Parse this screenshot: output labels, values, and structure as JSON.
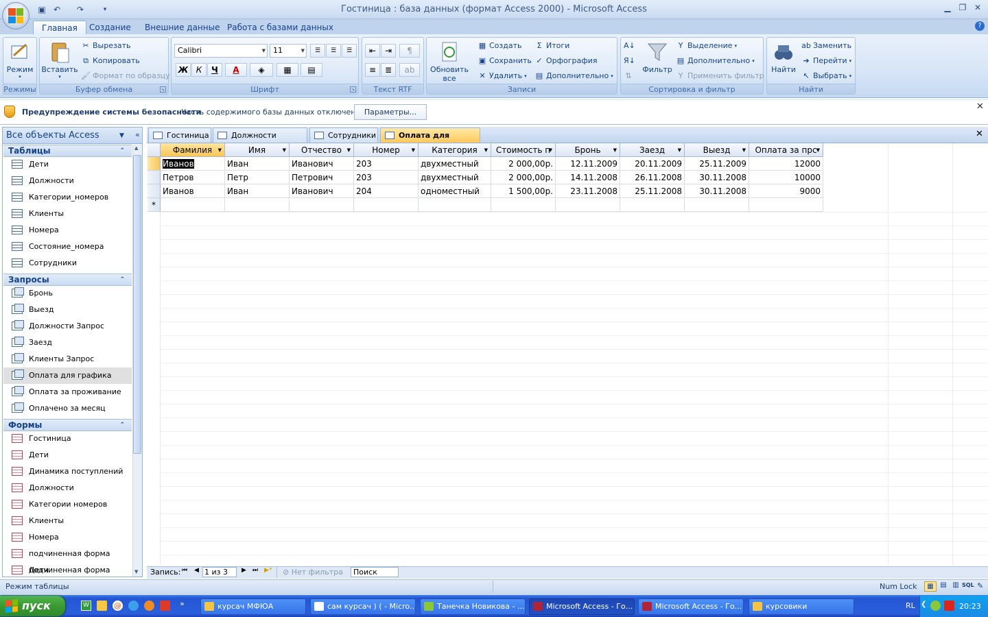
{
  "window": {
    "title": "Гостиница : база данных (формат Access 2000)  -  Microsoft Access",
    "minimize": "▁",
    "restore": "❐",
    "close": "✕"
  },
  "ribbon_tabs": [
    "Главная",
    "Создание",
    "Внешние данные",
    "Работа с базами данных"
  ],
  "ribbon": {
    "modes": {
      "label": "Режимы",
      "view": "Режим"
    },
    "clipboard": {
      "label": "Буфер обмена",
      "paste": "Вставить",
      "cut": "Вырезать",
      "copy": "Копировать",
      "format_painter": "Формат по образцу"
    },
    "font": {
      "label": "Шрифт",
      "font_name": "Calibri",
      "font_size": "11",
      "bold": "Ж",
      "italic": "К",
      "underline": "Ч",
      "font_color": "A"
    },
    "rtf": {
      "label": "Текст RTF"
    },
    "records": {
      "label": "Записи",
      "refresh": "Обновить все",
      "new": "Создать",
      "save": "Сохранить",
      "delete": "Удалить",
      "totals": "Итоги",
      "spelling": "Орфография",
      "more": "Дополнительно"
    },
    "sort_filter": {
      "label": "Сортировка и фильтр",
      "filter": "Фильтр",
      "selection": "Выделение",
      "advanced": "Дополнительно",
      "toggle_filter": "Применить фильтр"
    },
    "find": {
      "label": "Найти",
      "find": "Найти",
      "replace": "Заменить",
      "goto": "Перейти",
      "select": "Выбрать"
    }
  },
  "security_bar": {
    "title": "Предупреждение системы безопасности",
    "message": "Часть содержимого базы данных отключено",
    "options_button": "Параметры..."
  },
  "nav_pane": {
    "header": "Все объекты Access",
    "sections": [
      {
        "title": "Таблицы",
        "items": [
          "Дети",
          "Должности",
          "Категории_номеров",
          "Клиенты",
          "Номера",
          "Состояние_номера",
          "Сотрудники"
        ]
      },
      {
        "title": "Запросы",
        "items": [
          "Бронь",
          "Выезд",
          "Должности Запрос",
          "Заезд",
          "Клиенты Запрос",
          "Оплата для графика",
          "Оплата за проживание",
          "Оплачено за месяц"
        ]
      },
      {
        "title": "Формы",
        "items": [
          "Гостиница",
          "Дети",
          "Динамика поступлений",
          "Должности",
          "Категории номеров",
          "Клиенты",
          "Номера",
          "подчиненная форма Дети",
          "подчиненная форма Кат..."
        ]
      }
    ],
    "selected_item": "Оплата для графика"
  },
  "doc_tabs": [
    "Гостиница",
    "Должности Запрос",
    "Сотрудники",
    "Оплата для графика"
  ],
  "active_doc_tab": 3,
  "datasheet": {
    "columns": [
      "Фамилия",
      "Имя",
      "Отчество",
      "Номер",
      "Категория",
      "Стоимость п",
      "Бронь",
      "Заезд",
      "Выезд",
      "Оплата за прс"
    ],
    "rows": [
      [
        "Иванов",
        "Иван",
        "Иванович",
        "203",
        "двухместный",
        "2 000,00р.",
        "12.11.2009",
        "20.11.2009",
        "25.11.2009",
        "12000"
      ],
      [
        "Петров",
        "Петр",
        "Петрович",
        "203",
        "двухместный",
        "2 000,00р.",
        "14.11.2008",
        "26.11.2008",
        "30.11.2008",
        "10000"
      ],
      [
        "Иванов",
        "Иван",
        "Иванович",
        "204",
        "одноместный",
        "1 500,00р.",
        "23.11.2008",
        "25.11.2008",
        "30.11.2008",
        "9000"
      ]
    ],
    "new_row_marker": "*"
  },
  "record_nav": {
    "label": "Запись:",
    "position": "1 из 3",
    "filter": "Нет фильтра",
    "search": "Поиск"
  },
  "status_bar": {
    "mode": "Режим таблицы",
    "num_lock": "Num Lock",
    "sql": "SQL"
  },
  "taskbar": {
    "start": "пуск",
    "buttons": [
      "курсач МФЮА",
      "сам курсач ) ( - Micro...",
      "Танечка Новикова - ...",
      "Microsoft Access - Го...",
      "Microsoft Access - Го...",
      "курсовики"
    ],
    "active_index": 3,
    "lang": "RL",
    "clock": "20:23"
  }
}
